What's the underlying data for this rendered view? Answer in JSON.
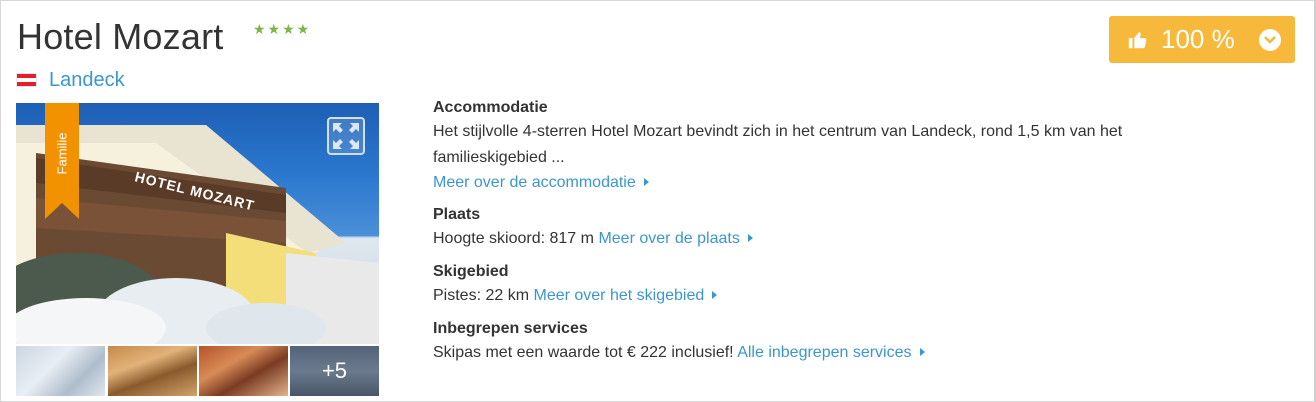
{
  "hotel": {
    "name": "Hotel Mozart",
    "stars": "★★★★",
    "location": "Landeck",
    "ribbon_label": "Familie",
    "more_photos": "+5"
  },
  "rating": {
    "value": "100 %"
  },
  "sections": {
    "accommodation": {
      "heading": "Accommodatie",
      "text_line1": "Het stijlvolle 4-sterren Hotel Mozart bevindt zich in het centrum van Landeck, rond 1,5 km van het",
      "text_line2": "familieskigebied ...",
      "link": "Meer over de accommodatie"
    },
    "place": {
      "heading": "Plaats",
      "text": "Hoogte skioord: 817 m",
      "link": "Meer over de plaats"
    },
    "skiarea": {
      "heading": "Skigebied",
      "text": "Pistes: 22 km",
      "link": "Meer over het skigebied"
    },
    "services": {
      "heading": "Inbegrepen services",
      "text": "Skipas met een waarde tot € 222 inclusief!",
      "link": "Alle inbegrepen services"
    }
  },
  "colors": {
    "accent_link": "#3b96cf",
    "rating_bg": "#f6b93b",
    "stars": "#7ab648",
    "ribbon": "#f39200"
  },
  "icons": {
    "thumb": "thumbs-up-icon",
    "dropdown": "chevron-down-icon",
    "expand": "expand-icon",
    "flag": "austria-flag-icon",
    "link_arrow": "arrow-right-icon"
  }
}
